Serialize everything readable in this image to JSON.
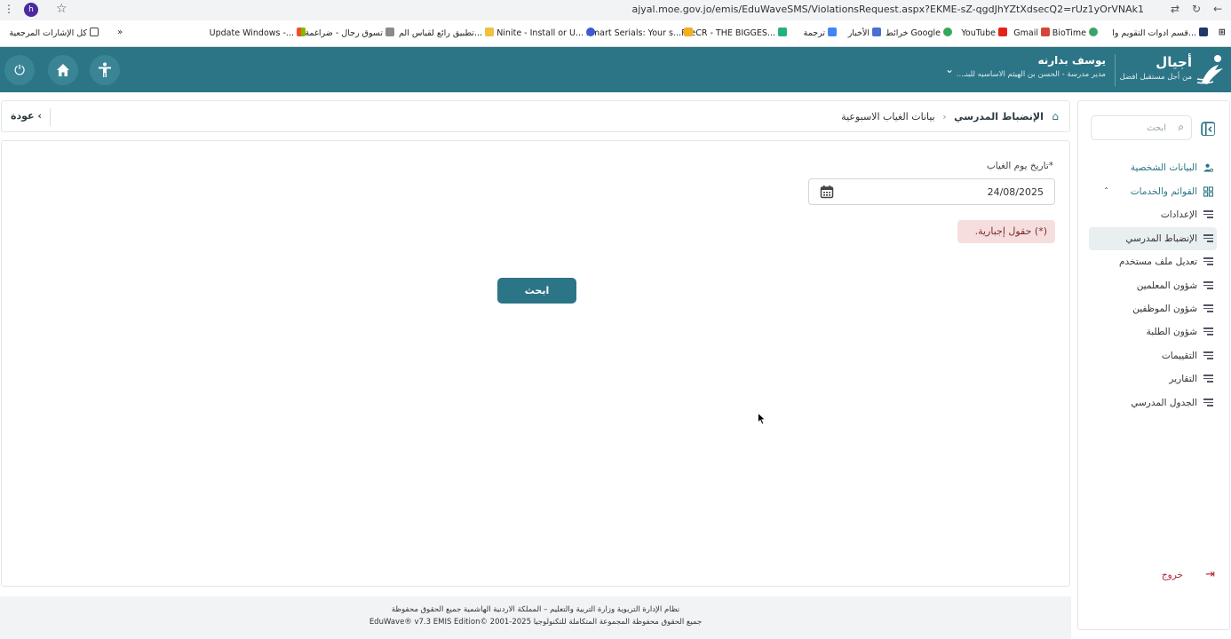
{
  "browser": {
    "url": "ajyal.moe.gov.jo/emis/EduWaveSMS/ViolationsRequest.aspx?EKME-sZ-qgdJhYZtXdsecQ2=rUz1yOrVNAk1",
    "avatar_letter": "h"
  },
  "bookmarks": [
    "قسم ادوات التقويم وا...",
    "BioTime",
    "Gmail",
    "YouTube",
    "خرائط Google",
    "الأخبار",
    "ترجمة",
    "FileCR - THE BIGGES...",
    "Smart Serials: Your s...",
    "Ninite - Install or U...",
    "تطبيق رائع لقياس الم...",
    "تسوق رجال - ضراغمة",
    "Update Windows -...",
    "كل الإشارات المرجعية"
  ],
  "header": {
    "brand_name": "أجيال",
    "brand_tagline": "من أجل مستقبل افضل",
    "user_name": "يوسف بدارنه",
    "user_role": "مدير مدرسة - الحسن بن الهيثم الاساسيه للبنـ...",
    "brand_color": "#2b7586"
  },
  "breadcrumb": {
    "level1": "الإنضباط المدرسي",
    "level2": "بيانات الغياب الاسبوعية",
    "back_label": "عودة"
  },
  "form": {
    "date_label": "*تاريخ يوم الغياب",
    "date_value": "24/08/2025",
    "required_note": "(*) حقول إجبارية.",
    "search_button": "ابحث"
  },
  "sidebar": {
    "search_placeholder": "ابحث",
    "items": [
      {
        "label": "البيانات الشخصية",
        "icon": "user-gear-icon"
      },
      {
        "label": "القوائم والخدمات",
        "icon": "grid-icon"
      },
      {
        "label": "الإعدادات",
        "icon": "lines-icon"
      },
      {
        "label": "الإنضباط المدرسي",
        "icon": "lines-icon",
        "active": true
      },
      {
        "label": "تعديل ملف مستخدم",
        "icon": "lines-icon"
      },
      {
        "label": "شؤون المعلمين",
        "icon": "lines-icon"
      },
      {
        "label": "شؤون الموظفين",
        "icon": "lines-icon"
      },
      {
        "label": "شؤون الطلبة",
        "icon": "lines-icon"
      },
      {
        "label": "التقييمات",
        "icon": "lines-icon"
      },
      {
        "label": "التقارير",
        "icon": "lines-icon"
      },
      {
        "label": "الجدول المدرسي",
        "icon": "lines-icon"
      }
    ],
    "logout_label": "خروج"
  },
  "footer": {
    "line1": "نظام الإدارة التربوية وزارة التربية والتعليم – المملكة الاردنية الهاشمية جميع الحقوق محفوظة",
    "line2": "EduWave® v7.3 EMIS Edition© 2001-2025 جميع الحقوق محفوظة المجموعة المتكاملة للتكنولوجيا"
  }
}
